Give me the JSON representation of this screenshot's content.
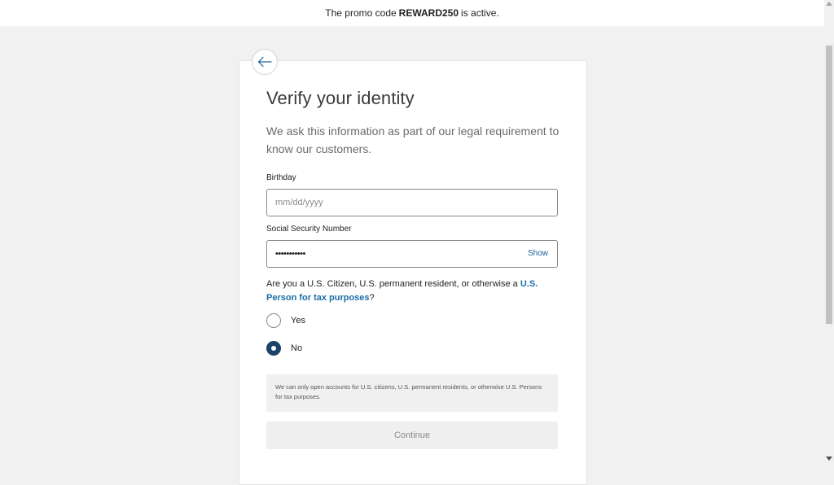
{
  "promo": {
    "prefix": "The promo code",
    "code": "REWARD250",
    "suffix": "is active."
  },
  "form": {
    "title": "Verify your identity",
    "subtitle": "We ask this information as part of our legal requirement to know our customers.",
    "birthday": {
      "label": "Birthday",
      "placeholder": "mm/dd/yyyy",
      "value": ""
    },
    "ssn": {
      "label": "Social Security Number",
      "masked_value": "•••••••••••",
      "show_label": "Show"
    },
    "question": {
      "text": "Are you a U.S. Citizen, U.S. permanent resident, or otherwise a",
      "link": "U.S. Person for tax purposes",
      "suffix": "?"
    },
    "options": [
      {
        "label": "Yes",
        "selected": false
      },
      {
        "label": "No",
        "selected": true
      }
    ],
    "notice": "We can only open accounts for U.S. citizens, U.S. permanent residents, or otherwise U.S. Persons for tax purposes.",
    "continue_label": "Continue",
    "continue_enabled": false
  },
  "icons": {
    "back": "arrow-left-icon"
  },
  "colors": {
    "link": "#1a6ea8",
    "radio_selected": "#1c4367",
    "page_background": "#f1f1f1"
  }
}
